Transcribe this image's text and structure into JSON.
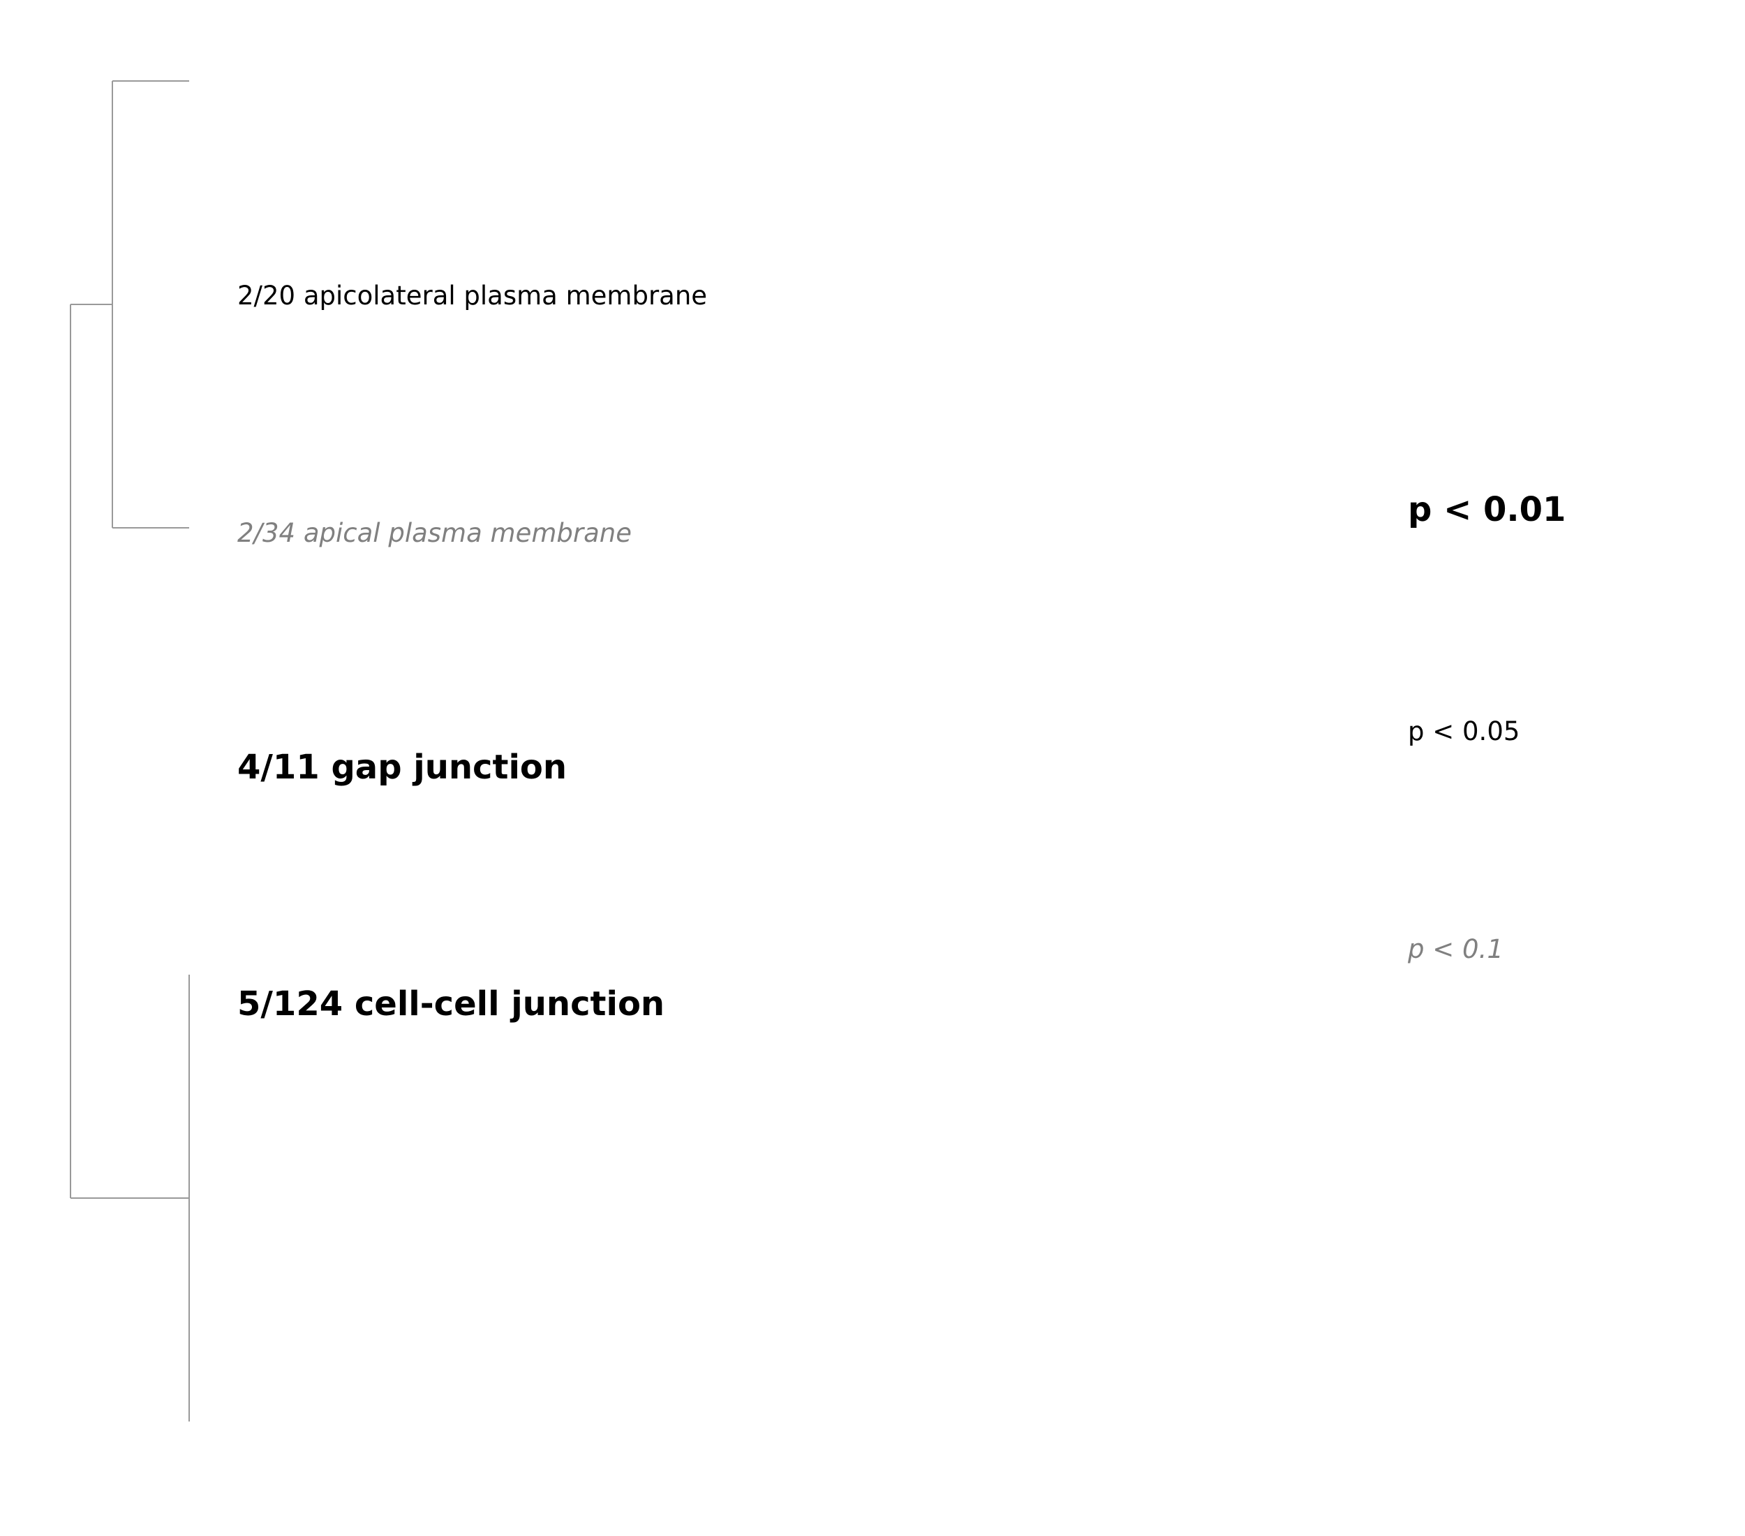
{
  "terms": [
    {
      "label": "2/20 apicolateral plasma membrane",
      "significance": "p < 0.05"
    },
    {
      "label": "2/34 apical plasma membrane",
      "significance": "p < 0.1"
    },
    {
      "label": "4/11 gap junction",
      "significance": "p < 0.01"
    },
    {
      "label": "5/124 cell-cell junction",
      "significance": "p < 0.01"
    }
  ],
  "legend": {
    "strong": "p < 0.01",
    "mid": "p < 0.05",
    "weak": "p < 0.1"
  },
  "colors": {
    "tree_line": "#999999",
    "strong_text": "#000000",
    "mid_text": "#000000",
    "weak_text": "#808080"
  }
}
